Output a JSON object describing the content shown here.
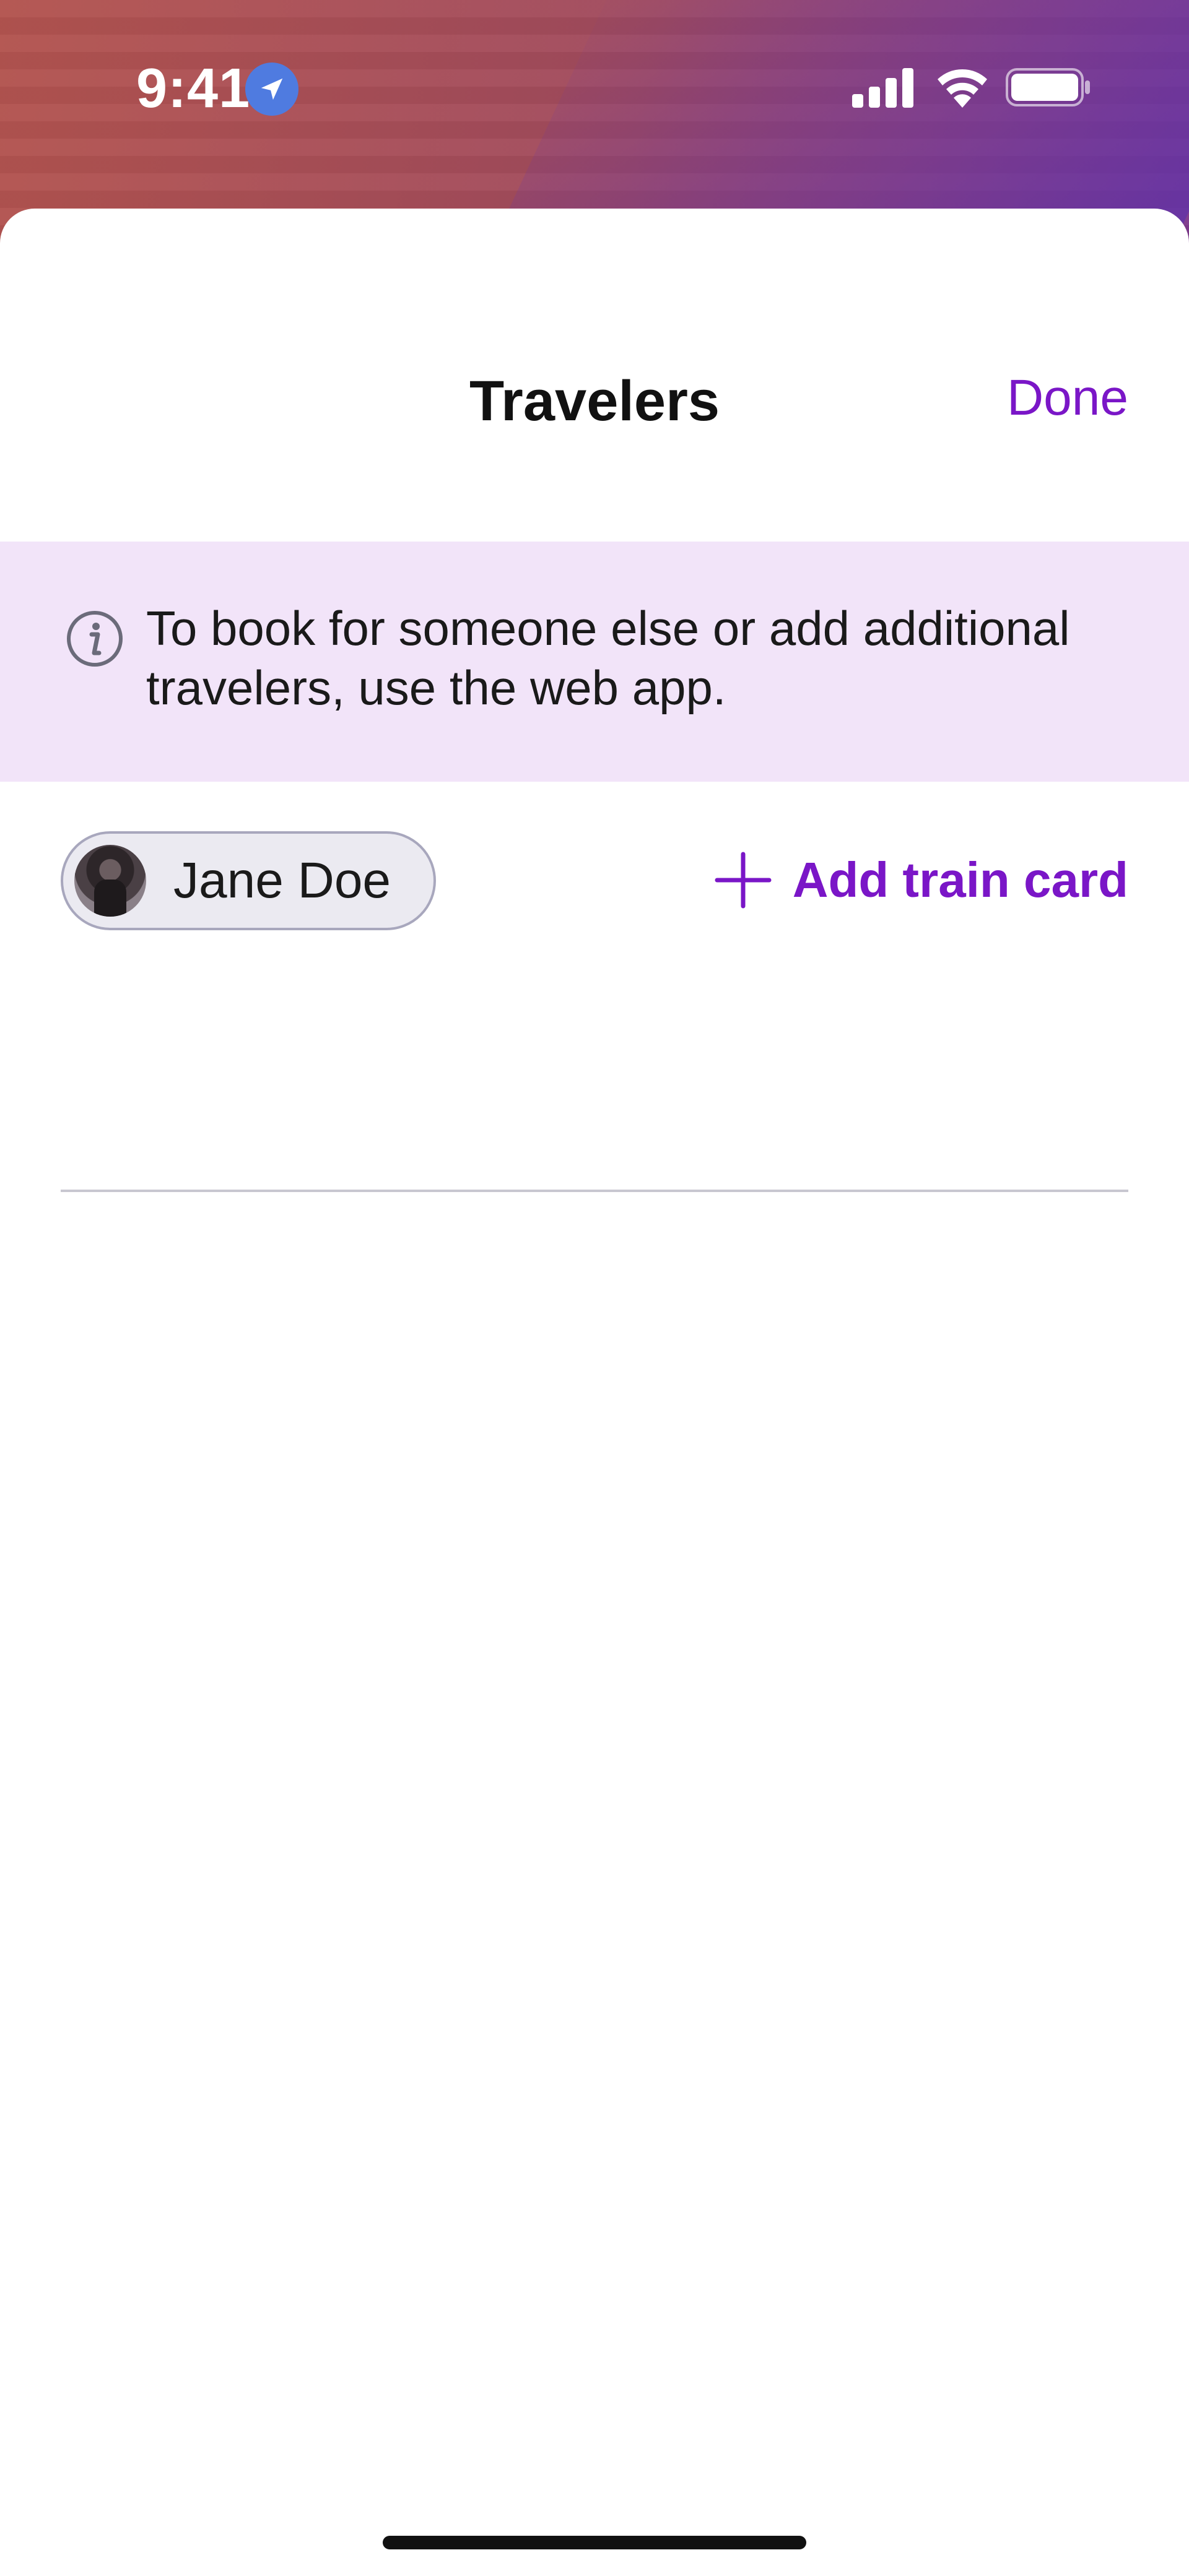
{
  "status_bar": {
    "time": "9:41",
    "icons": [
      "location-arrow-icon",
      "signal-bars-icon",
      "wifi-icon",
      "battery-icon"
    ]
  },
  "header": {
    "title": "Travelers",
    "done_label": "Done"
  },
  "info_banner": {
    "icon": "info-icon",
    "text": "To book for someone else or add additional travelers, use the web app."
  },
  "traveler": {
    "name": "Jane Doe",
    "avatar": "avatar-photo"
  },
  "add_train_card": {
    "icon": "plus-icon",
    "label": "Add train card"
  },
  "colors": {
    "accent": "#7a16c7",
    "banner_bg": "#f2e4f9",
    "chip_bg": "#ebeaf1",
    "chip_border": "#a8a7bd"
  }
}
